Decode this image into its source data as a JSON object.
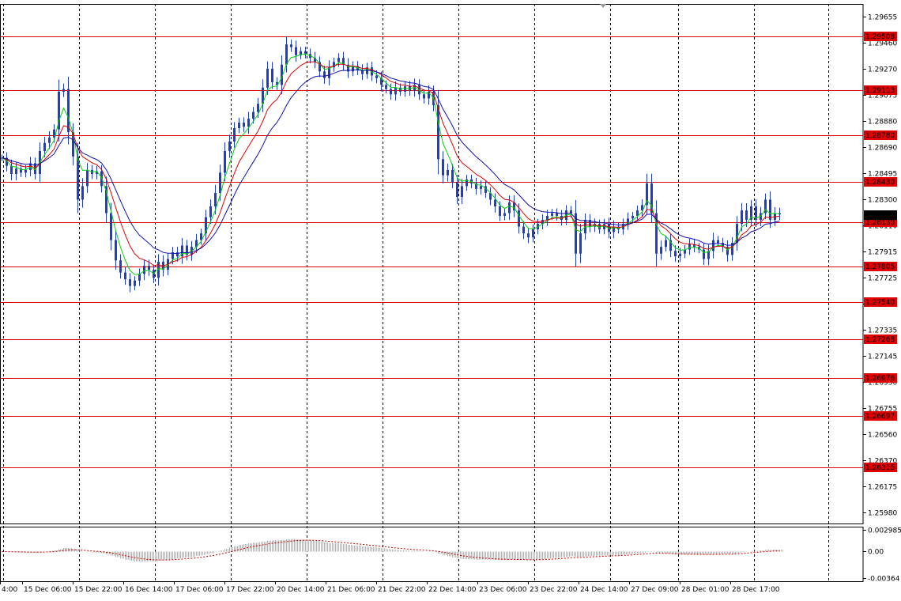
{
  "chart_data": {
    "type": "candlestick",
    "instrument_note": "",
    "price_axis": {
      "min": 1.259,
      "max": 1.2975,
      "ticks": [
        1.29655,
        1.2946,
        1.2927,
        1.29075,
        1.2888,
        1.2869,
        1.28495,
        1.283,
        1.2811,
        1.27915,
        1.27725,
        1.2753,
        1.27335,
        1.27145,
        1.2695,
        1.26755,
        1.2656,
        1.2637,
        1.26175,
        1.2598
      ],
      "tick_labels": [
        "1.29655",
        "1.29460",
        "1.29270",
        "1.29075",
        "1.28880",
        "1.28690",
        "1.28495",
        "1.28300",
        "1.28110",
        "1.27915",
        "1.27725",
        "1.27530",
        "1.27335",
        "1.27145",
        "1.26950",
        "1.26755",
        "1.26560",
        "1.26370",
        "1.26175",
        "1.25980"
      ]
    },
    "time_axis": {
      "labels": [
        "4:00",
        "15 Dec 06:00",
        "15 Dec 22:00",
        "16 Dec 14:00",
        "17 Dec 06:00",
        "17 Dec 22:00",
        "20 Dec 14:00",
        "21 Dec 06:00",
        "21 Dec 22:00",
        "22 Dec 14:00",
        "23 Dec 06:00",
        "23 Dec 22:00",
        "24 Dec 14:00",
        "27 Dec 09:00",
        "28 Dec 01:00",
        "28 Dec 17:00"
      ]
    },
    "levels": [
      {
        "value": 1.29508,
        "label": "1.29508"
      },
      {
        "value": 1.29113,
        "label": "1.29113"
      },
      {
        "value": 1.2878,
        "label": "1.28780"
      },
      {
        "value": 1.2843,
        "label": "1.28430"
      },
      {
        "value": 1.2813,
        "label": "1.28130"
      },
      {
        "value": 1.27805,
        "label": "1.27805"
      },
      {
        "value": 1.2754,
        "label": "1.27540"
      },
      {
        "value": 1.27268,
        "label": "1.27268"
      },
      {
        "value": 1.26976,
        "label": "1.26976"
      },
      {
        "value": 1.26697,
        "label": "1.26697"
      },
      {
        "value": 1.26315,
        "label": "1.26315"
      }
    ],
    "current_price": {
      "value": 1.28187,
      "label": "1.28187"
    },
    "close_path": [
      [
        0,
        1.2861
      ],
      [
        6,
        1.2855
      ],
      [
        12,
        1.2849
      ],
      [
        18,
        1.2853
      ],
      [
        24,
        1.285
      ],
      [
        30,
        1.2852
      ],
      [
        36,
        1.2857
      ],
      [
        42,
        1.2849
      ],
      [
        48,
        1.2866
      ],
      [
        54,
        1.2872
      ],
      [
        60,
        1.2876
      ],
      [
        66,
        1.2882
      ],
      [
        72,
        1.291
      ],
      [
        78,
        1.2912
      ],
      [
        84,
        1.288
      ],
      [
        90,
        1.2862
      ],
      [
        96,
        1.283
      ],
      [
        102,
        1.284
      ],
      [
        108,
        1.2852
      ],
      [
        114,
        1.2849
      ],
      [
        120,
        1.2851
      ],
      [
        126,
        1.284
      ],
      [
        132,
        1.282
      ],
      [
        138,
        1.28
      ],
      [
        144,
        1.2785
      ],
      [
        150,
        1.2776
      ],
      [
        156,
        1.2771
      ],
      [
        162,
        1.2766
      ],
      [
        168,
        1.277
      ],
      [
        174,
        1.2775
      ],
      [
        180,
        1.2781
      ],
      [
        186,
        1.2778
      ],
      [
        192,
        1.2772
      ],
      [
        198,
        1.2784
      ],
      [
        204,
        1.2778
      ],
      [
        210,
        1.2786
      ],
      [
        216,
        1.2791
      ],
      [
        222,
        1.2788
      ],
      [
        228,
        1.2796
      ],
      [
        234,
        1.2789
      ],
      [
        240,
        1.2795
      ],
      [
        246,
        1.28
      ],
      [
        252,
        1.2805
      ],
      [
        258,
        1.2817
      ],
      [
        264,
        1.2825
      ],
      [
        270,
        1.2835
      ],
      [
        276,
        1.285
      ],
      [
        282,
        1.2866
      ],
      [
        288,
        1.2873
      ],
      [
        294,
        1.2883
      ],
      [
        300,
        1.2887
      ],
      [
        306,
        1.2884
      ],
      [
        312,
        1.289
      ],
      [
        318,
        1.2895
      ],
      [
        324,
        1.2901
      ],
      [
        330,
        1.2913
      ],
      [
        336,
        1.2927
      ],
      [
        342,
        1.2917
      ],
      [
        348,
        1.2915
      ],
      [
        354,
        1.293
      ],
      [
        360,
        1.2945
      ],
      [
        366,
        1.2943
      ],
      [
        372,
        1.2937
      ],
      [
        378,
        1.294
      ],
      [
        384,
        1.2938
      ],
      [
        390,
        1.2935
      ],
      [
        396,
        1.2932
      ],
      [
        402,
        1.2925
      ],
      [
        408,
        1.292
      ],
      [
        414,
        1.2928
      ],
      [
        420,
        1.2932
      ],
      [
        426,
        1.2935
      ],
      [
        432,
        1.293
      ],
      [
        438,
        1.2925
      ],
      [
        444,
        1.2929
      ],
      [
        450,
        1.2926
      ],
      [
        456,
        1.2923
      ],
      [
        462,
        1.2928
      ],
      [
        468,
        1.2922
      ],
      [
        474,
        1.292
      ],
      [
        480,
        1.2915
      ],
      [
        486,
        1.2912
      ],
      [
        492,
        1.2908
      ],
      [
        498,
        1.2913
      ],
      [
        504,
        1.291
      ],
      [
        510,
        1.2914
      ],
      [
        516,
        1.2911
      ],
      [
        522,
        1.2915
      ],
      [
        528,
        1.2908
      ],
      [
        534,
        1.2905
      ],
      [
        540,
        1.291
      ],
      [
        546,
        1.29
      ],
      [
        552,
        1.286
      ],
      [
        558,
        1.2848
      ],
      [
        564,
        1.2852
      ],
      [
        570,
        1.2843
      ],
      [
        576,
        1.2832
      ],
      [
        582,
        1.284
      ],
      [
        588,
        1.2845
      ],
      [
        594,
        1.2842
      ],
      [
        600,
        1.2838
      ],
      [
        606,
        1.284
      ],
      [
        612,
        1.2835
      ],
      [
        618,
        1.283
      ],
      [
        624,
        1.2825
      ],
      [
        630,
        1.2818
      ],
      [
        636,
        1.282
      ],
      [
        642,
        1.2828
      ],
      [
        648,
        1.2822
      ],
      [
        654,
        1.281
      ],
      [
        660,
        1.2805
      ],
      [
        666,
        1.2802
      ],
      [
        672,
        1.2808
      ],
      [
        678,
        1.2812
      ],
      [
        684,
        1.2815
      ],
      [
        690,
        1.2818
      ],
      [
        696,
        1.282
      ],
      [
        702,
        1.2818
      ],
      [
        708,
        1.2815
      ],
      [
        714,
        1.2822
      ],
      [
        720,
        1.282
      ],
      [
        726,
        1.279
      ],
      [
        732,
        1.2805
      ],
      [
        738,
        1.2815
      ],
      [
        744,
        1.281
      ],
      [
        750,
        1.2812
      ],
      [
        756,
        1.2808
      ],
      [
        762,
        1.2812
      ],
      [
        768,
        1.2806
      ],
      [
        774,
        1.281
      ],
      [
        780,
        1.2808
      ],
      [
        786,
        1.2812
      ],
      [
        792,
        1.2816
      ],
      [
        798,
        1.2818
      ],
      [
        804,
        1.2822
      ],
      [
        810,
        1.2826
      ],
      [
        816,
        1.2842
      ],
      [
        822,
        1.282
      ],
      [
        828,
        1.279
      ],
      [
        834,
        1.2795
      ],
      [
        840,
        1.28
      ],
      [
        846,
        1.2792
      ],
      [
        852,
        1.2788
      ],
      [
        858,
        1.279
      ],
      [
        864,
        1.2793
      ],
      [
        870,
        1.2797
      ],
      [
        876,
        1.2795
      ],
      [
        882,
        1.2793
      ],
      [
        888,
        1.2786
      ],
      [
        894,
        1.2792
      ],
      [
        900,
        1.28
      ],
      [
        906,
        1.2798
      ],
      [
        912,
        1.2795
      ],
      [
        918,
        1.2789
      ],
      [
        924,
        1.2798
      ],
      [
        930,
        1.2812
      ],
      [
        936,
        1.2822
      ],
      [
        942,
        1.2815
      ],
      [
        948,
        1.2825
      ],
      [
        954,
        1.2815
      ],
      [
        960,
        1.282
      ],
      [
        966,
        1.283
      ],
      [
        972,
        1.2815
      ],
      [
        978,
        1.282
      ],
      [
        984,
        1.2819
      ]
    ],
    "oscillator": {
      "axis_labels": [
        "0.002985",
        "0.00",
        "-0.00364"
      ],
      "axis_values": [
        0.002985,
        0.0,
        -0.00364
      ]
    },
    "colors": {
      "candle": "#1e3ccd",
      "ma_fast": "#00d400",
      "ma_mid": "#e00000",
      "ma_slow": "#1010b0",
      "level": "#e00000",
      "level_label_bg": "#e00000",
      "current_label_bg": "#000000",
      "grid": "#000000",
      "osc_hist": "#b4b4b4",
      "osc_signal": "#c80000"
    }
  }
}
